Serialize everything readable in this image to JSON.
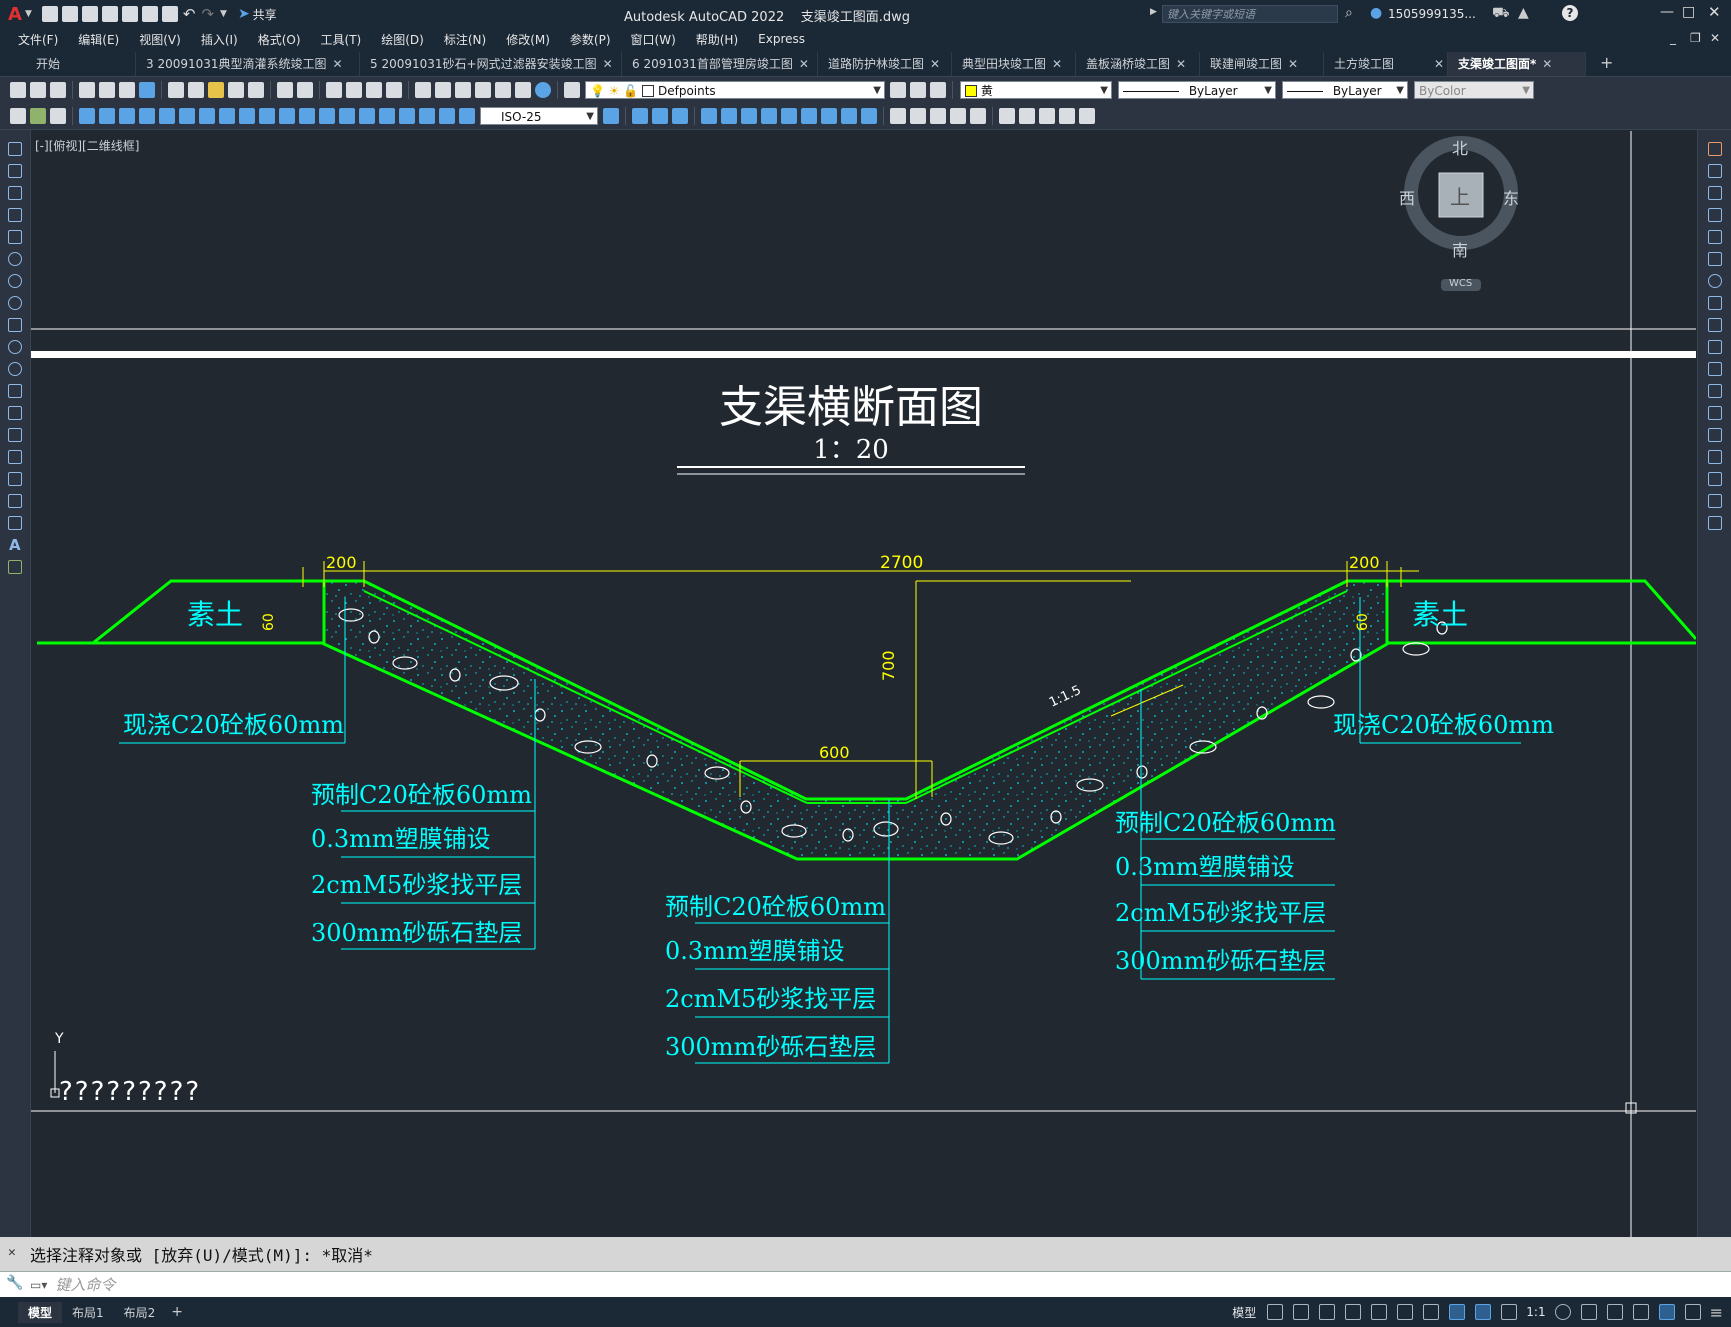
{
  "app": {
    "title": "Autodesk AutoCAD 2022",
    "filename": "支渠竣工图面.dwg",
    "share_label": "共享",
    "search_placeholder": "键入关键字或短语",
    "user": "1505999135..."
  },
  "menu": [
    "文件(F)",
    "编辑(E)",
    "视图(V)",
    "插入(I)",
    "格式(O)",
    "工具(T)",
    "绘图(D)",
    "标注(N)",
    "修改(M)",
    "参数(P)",
    "窗口(W)",
    "帮助(H)",
    "Express"
  ],
  "tabs": [
    {
      "label": "开始",
      "active": false,
      "closable": false
    },
    {
      "label": "3  20091031典型滴灌系统竣工图",
      "active": false,
      "closable": true
    },
    {
      "label": "5  20091031砂石+网式过滤器安装竣工图",
      "active": false,
      "closable": true
    },
    {
      "label": "6  2091031首部管理房竣工图",
      "active": false,
      "closable": true
    },
    {
      "label": "道路防护林竣工图",
      "active": false,
      "closable": true
    },
    {
      "label": "典型田块竣工图",
      "active": false,
      "closable": true
    },
    {
      "label": "盖板涵桥竣工图",
      "active": false,
      "closable": true
    },
    {
      "label": "联建闸竣工图",
      "active": false,
      "closable": true
    },
    {
      "label": "土方竣工图",
      "active": false,
      "closable": true
    },
    {
      "label": "支渠竣工图面*",
      "active": true,
      "closable": true
    }
  ],
  "toolbar": {
    "layer": "Defpoints",
    "color": "黄",
    "linetype": "ByLayer",
    "lineweight": "ByLayer",
    "plotstyle": "ByColor",
    "dimstyle": "ISO-25"
  },
  "viewport": {
    "label": "[-][俯视][二维线框]",
    "viewcube": {
      "north": "北",
      "south": "南",
      "east": "东",
      "west": "西",
      "top": "上",
      "wcs": "WCS"
    },
    "ucs_y": "Y",
    "ucs_text": "?????????"
  },
  "drawing": {
    "title": "支渠横断面图",
    "scale": "1：20",
    "dims": {
      "left_top": "200",
      "right_top": "200",
      "span": "2700",
      "bottom": "600",
      "depth": "700",
      "left_edge": "60",
      "right_edge": "60",
      "slope": "1:1.5"
    },
    "soil_left": "素土",
    "soil_right": "素土",
    "label_left_top": "现浇C20砼板60mm",
    "label_right_top": "现浇C20砼板60mm",
    "layers_left": [
      "预制C20砼板60mm",
      "0.3mm塑膜铺设",
      "2cmM5砂浆找平层",
      "300mm砂砾石垫层"
    ],
    "layers_center": [
      "预制C20砼板60mm",
      "0.3mm塑膜铺设",
      "2cmM5砂浆找平层",
      "300mm砂砾石垫层"
    ],
    "layers_right": [
      "预制C20砼板60mm",
      "0.3mm塑膜铺设",
      "2cmM5砂浆找平层",
      "300mm砂砾石垫层"
    ]
  },
  "command": {
    "history": "选择注释对象或 [放弃(U)/模式(M)]: *取消*",
    "placeholder": "键入命令"
  },
  "layouts": [
    "模型",
    "布局1",
    "布局2"
  ],
  "status": {
    "model": "模型",
    "scale": "1:1"
  },
  "colors": {
    "background": "#212830",
    "outline": "#00ff00",
    "label": "#00ffff",
    "dimension": "#ffff00",
    "text": "#ffffff"
  }
}
